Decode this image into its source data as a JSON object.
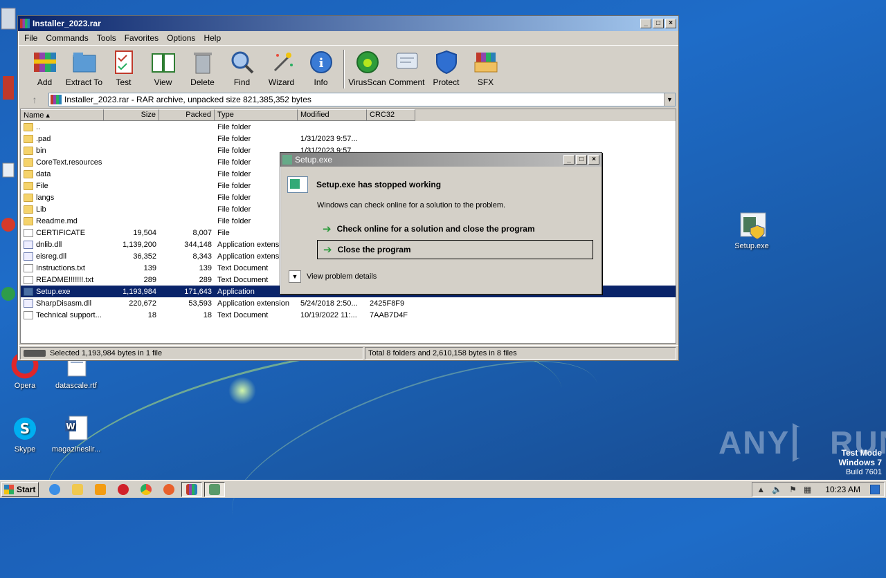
{
  "desktop": {
    "icons_left": [
      {
        "label": "Opera"
      },
      {
        "label": "datascale.rtf"
      },
      {
        "label": "Skype"
      },
      {
        "label": "magazineslir..."
      }
    ],
    "icons_right": [
      {
        "label": "Setup.exe"
      }
    ],
    "watermark": "ANY RUN",
    "watermark_left": "ANY",
    "watermark_right": "RUN",
    "test_mode": {
      "line1": "Test Mode",
      "line2": "Windows 7",
      "line3": "Build 7601"
    }
  },
  "winrar": {
    "title": "Installer_2023.rar",
    "menu": [
      "File",
      "Commands",
      "Tools",
      "Favorites",
      "Options",
      "Help"
    ],
    "toolbar": [
      "Add",
      "Extract To",
      "Test",
      "View",
      "Delete",
      "Find",
      "Wizard",
      "Info",
      "VirusScan",
      "Comment",
      "Protect",
      "SFX"
    ],
    "address": "Installer_2023.rar - RAR archive, unpacked size 821,385,352 bytes",
    "columns": [
      "Name",
      "Size",
      "Packed",
      "Type",
      "Modified",
      "CRC32"
    ],
    "rows": [
      {
        "name": "..",
        "size": "",
        "packed": "",
        "type": "File folder",
        "modified": "",
        "crc": "",
        "kind": "folder"
      },
      {
        "name": ".pad",
        "size": "",
        "packed": "",
        "type": "File folder",
        "modified": "1/31/2023 9:57...",
        "crc": "",
        "kind": "folder"
      },
      {
        "name": "bin",
        "size": "",
        "packed": "",
        "type": "File folder",
        "modified": "1/31/2023 9:57...",
        "crc": "",
        "kind": "folder"
      },
      {
        "name": "CoreText.resources",
        "size": "",
        "packed": "",
        "type": "File folder",
        "modified": "",
        "crc": "",
        "kind": "folder"
      },
      {
        "name": "data",
        "size": "",
        "packed": "",
        "type": "File folder",
        "modified": "",
        "crc": "",
        "kind": "folder"
      },
      {
        "name": "File",
        "size": "",
        "packed": "",
        "type": "File folder",
        "modified": "",
        "crc": "",
        "kind": "folder"
      },
      {
        "name": "langs",
        "size": "",
        "packed": "",
        "type": "File folder",
        "modified": "",
        "crc": "",
        "kind": "folder"
      },
      {
        "name": "Lib",
        "size": "",
        "packed": "",
        "type": "File folder",
        "modified": "",
        "crc": "",
        "kind": "folder"
      },
      {
        "name": "Readme.md",
        "size": "",
        "packed": "",
        "type": "File folder",
        "modified": "",
        "crc": "",
        "kind": "folder"
      },
      {
        "name": "CERTIFICATE",
        "size": "19,504",
        "packed": "8,007",
        "type": "File",
        "modified": "",
        "crc": "",
        "kind": "doc"
      },
      {
        "name": "dnlib.dll",
        "size": "1,139,200",
        "packed": "344,148",
        "type": "Application extensi",
        "modified": "",
        "crc": "",
        "kind": "dll"
      },
      {
        "name": "eisreg.dll",
        "size": "36,352",
        "packed": "8,343",
        "type": "Application extensi",
        "modified": "",
        "crc": "",
        "kind": "dll"
      },
      {
        "name": "Instructions.txt",
        "size": "139",
        "packed": "139",
        "type": "Text Document",
        "modified": "",
        "crc": "",
        "kind": "doc"
      },
      {
        "name": "README!!!!!!!.txt",
        "size": "289",
        "packed": "289",
        "type": "Text Document",
        "modified": "",
        "crc": "",
        "kind": "doc"
      },
      {
        "name": "Setup.exe",
        "size": "1,193,984",
        "packed": "171,643",
        "type": "Application",
        "modified": "",
        "crc": "",
        "kind": "app",
        "selected": true
      },
      {
        "name": "SharpDisasm.dll",
        "size": "220,672",
        "packed": "53,593",
        "type": "Application extension",
        "modified": "5/24/2018 2:50...",
        "crc": "2425F8F9",
        "kind": "dll"
      },
      {
        "name": "Technical support...",
        "size": "18",
        "packed": "18",
        "type": "Text Document",
        "modified": "10/19/2022 11:...",
        "crc": "7AAB7D4F",
        "kind": "doc"
      }
    ],
    "status_left": "Selected 1,193,984 bytes in 1 file",
    "status_right": "Total 8 folders and 2,610,158 bytes in 8 files"
  },
  "dialog": {
    "title": "Setup.exe",
    "heading": "Setup.exe has stopped working",
    "subtext": "Windows can check online for a solution to the problem.",
    "option1": "Check online for a solution and close the program",
    "option2": "Close the program",
    "details": "View problem details"
  },
  "taskbar": {
    "start": "Start",
    "clock": "10:23 AM"
  }
}
